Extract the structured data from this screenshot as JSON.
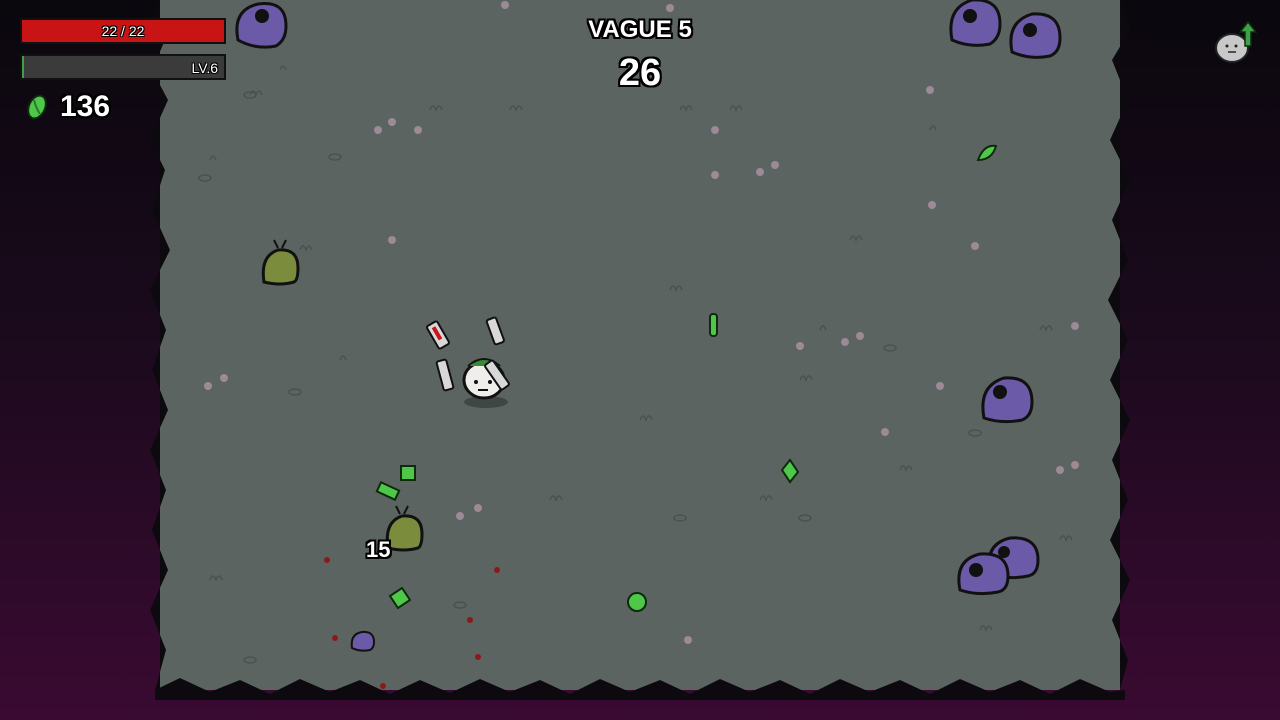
{
  "hud": {
    "hp_text": "22 / 22",
    "hp_fraction": 1.0,
    "level_text": "LV.6",
    "xp_fraction": 0.01,
    "materials_count": "136"
  },
  "wave": {
    "label": "VAGUE 5",
    "timer": "26"
  },
  "damage_numbers": [
    "15"
  ],
  "colors": {
    "hp": "#c81414",
    "xp": "#3fa04a",
    "arena_floor": "#5b6460",
    "enemy_purple": "#6b5aa8",
    "material_green": "#4fc84a"
  },
  "icons": {
    "material": "material-icon",
    "level_up": "level-up-icon"
  }
}
